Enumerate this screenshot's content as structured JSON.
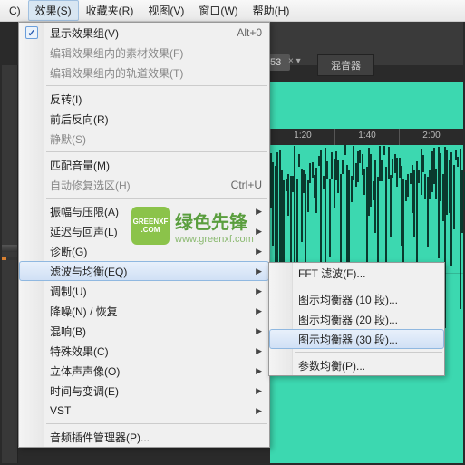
{
  "menubar": {
    "items": [
      "C)",
      "效果(S)",
      "收藏夹(R)",
      "视图(V)",
      "窗口(W)",
      "帮助(H)"
    ],
    "activeIndex": 1
  },
  "effectsMenu": {
    "showEffectGroup": {
      "label": "显示效果组(V)",
      "shortcut": "Alt+0",
      "checked": true
    },
    "editMaterialEffects": "编辑效果组内的素材效果(F)",
    "editTrackEffects": "编辑效果组内的轨道效果(T)",
    "reverse": "反转(I)",
    "forwardBackward": "前后反向(R)",
    "silence": "静默(S)",
    "matchVolume": "匹配音量(M)",
    "autoRepairSelection": {
      "label": "自动修复选区(H)",
      "shortcut": "Ctrl+U"
    },
    "amplitudeCompression": "振幅与压限(A)",
    "delayEcho": "延迟与回声(L)",
    "diagnosis": "诊断(G)",
    "filterEQ": "滤波与均衡(EQ)",
    "modulation": "调制(U)",
    "noiseReduction": "降噪(N) / 恢复",
    "reverb": "混响(B)",
    "specialEffects": "特殊效果(C)",
    "stereoImage": "立体声声像(O)",
    "timePitch": "时间与变调(E)",
    "vst": "VST",
    "audioPluginManager": "音频插件管理器(P)..."
  },
  "eqSubmenu": {
    "fftFilter": "FFT 滤波(F)...",
    "graphic10": "图示均衡器 (10 段)...",
    "graphic20": "图示均衡器 (20 段)...",
    "graphic30": "图示均衡器 (30 段)...",
    "parametric": "参数均衡(P)..."
  },
  "toolbar": {
    "tab53": "53",
    "mixerTab": "混音器",
    "extras": "× ▾"
  },
  "timeline": {
    "marks": [
      "1:20",
      "1:40",
      "2:00"
    ]
  },
  "watermark": {
    "logoTop": "GREENXF",
    "logoBottom": ".COM",
    "title": "绿色先锋",
    "url": "www.greenxf.com"
  }
}
